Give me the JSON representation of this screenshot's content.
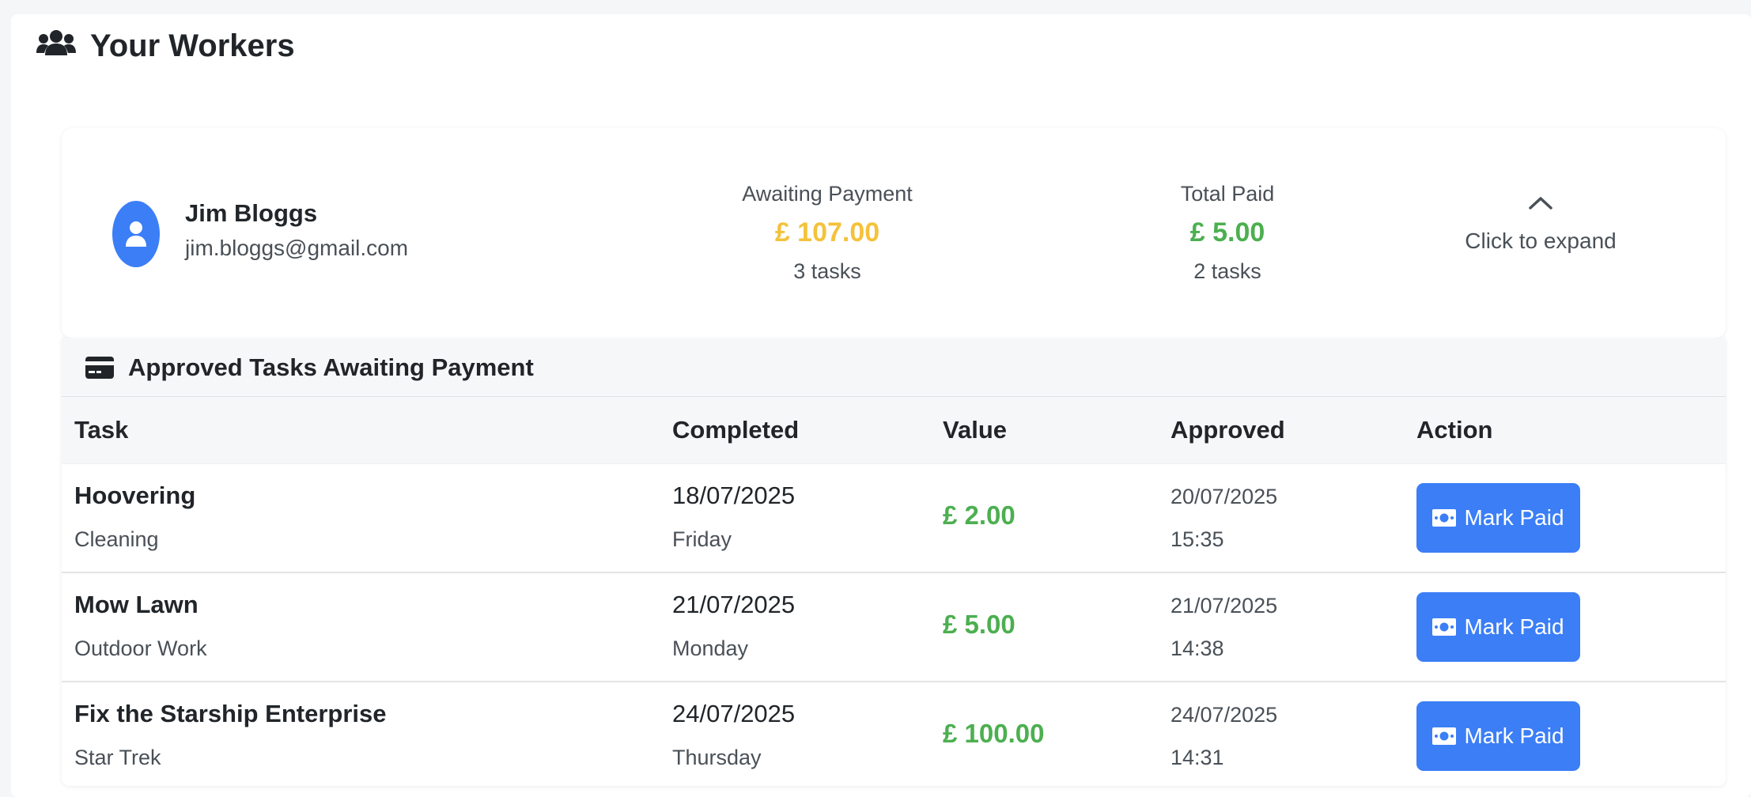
{
  "header": {
    "title": "Your Workers",
    "icon": "users-icon"
  },
  "worker": {
    "name": "Jim Bloggs",
    "email": "jim.bloggs@gmail.com",
    "awaiting": {
      "label": "Awaiting Payment",
      "amount": "£ 107.00",
      "count": "3 tasks",
      "color": "#f4c23a"
    },
    "paid": {
      "label": "Total Paid",
      "amount": "£ 5.00",
      "count": "2 tasks",
      "color": "#4caf50"
    },
    "expand_label": "Click to expand"
  },
  "section": {
    "title": "Approved Tasks Awaiting Payment",
    "columns": [
      "Task",
      "Completed",
      "Value",
      "Approved",
      "Action"
    ],
    "rows": [
      {
        "task": "Hoovering",
        "category": "Cleaning",
        "completed_date": "18/07/2025",
        "completed_day": "Friday",
        "value": "£ 2.00",
        "approved_date": "20/07/2025",
        "approved_time": "15:35",
        "action": "Mark Paid"
      },
      {
        "task": "Mow Lawn",
        "category": "Outdoor Work",
        "completed_date": "21/07/2025",
        "completed_day": "Monday",
        "value": "£ 5.00",
        "approved_date": "21/07/2025",
        "approved_time": "14:38",
        "action": "Mark Paid"
      },
      {
        "task": "Fix the Starship Enterprise",
        "category": "Star Trek",
        "completed_date": "24/07/2025",
        "completed_day": "Thursday",
        "value": "£ 100.00",
        "approved_date": "24/07/2025",
        "approved_time": "14:31",
        "action": "Mark Paid"
      }
    ]
  },
  "colors": {
    "accent": "#3b7ef6",
    "positive": "#4caf50",
    "pending": "#f4c23a"
  }
}
